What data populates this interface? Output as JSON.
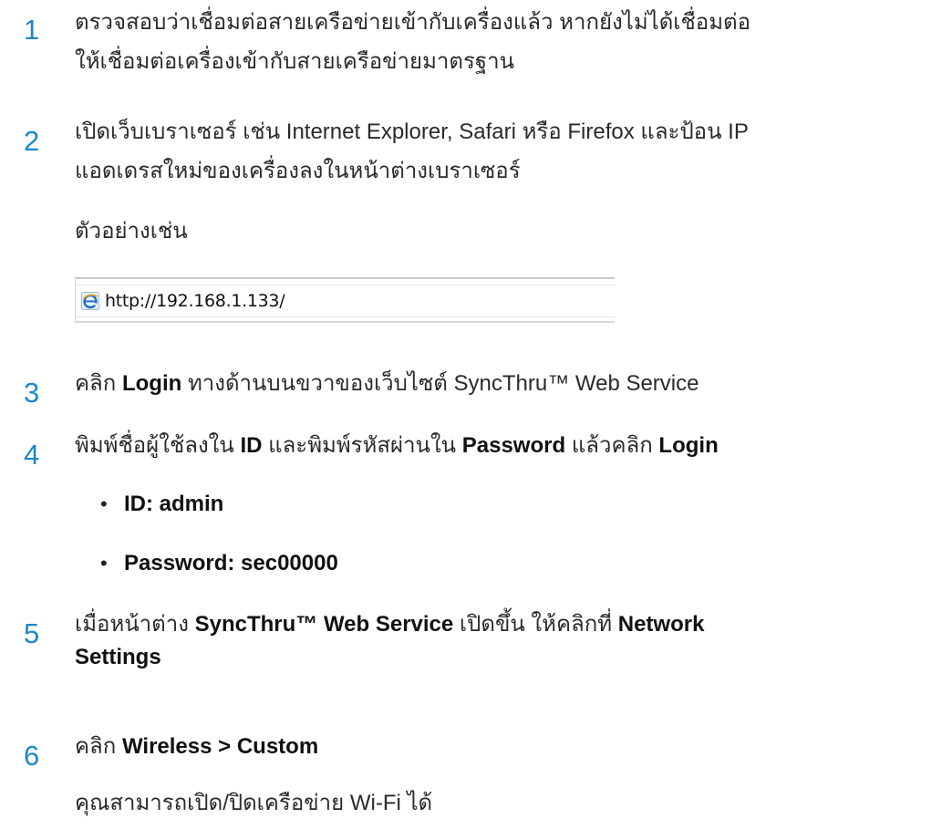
{
  "steps": [
    {
      "number": "1",
      "lines": [
        "ตรวจสอบว่าเชื่อมต่อสายเครือข่ายเข้ากับเครื่องแล้ว หากยังไม่ได้เชื่อมต่อ",
        "ให้เชื่อมต่อเครื่องเข้ากับสายเครือข่ายมาตรฐาน"
      ]
    },
    {
      "number": "2",
      "lines": [
        "เปิดเว็บเบราเซอร์ เช่น Internet Explorer, Safari หรือ Firefox และป้อน IP",
        "แอดเดรสใหม่ของเครื่องลงในหน้าต่างเบราเซอร์"
      ],
      "example_label": "ตัวอย่างเช่น",
      "example_url": "http://192.168.1.133/"
    },
    {
      "number": "3",
      "parts": [
        "คลิก ",
        "Login",
        " ทางด้านบนขวาของเว็บไซต์ SyncThru™ Web Service"
      ]
    },
    {
      "number": "4",
      "parts": [
        "พิมพ์ชื่อผู้ใช้ลงใน ",
        "ID",
        " และพิมพ์รหัสผ่านใน ",
        "Password",
        " แล้วคลิก ",
        "Login"
      ],
      "bullet_mark": "•",
      "bullets": [
        "ID: admin",
        "Password: sec00000"
      ]
    },
    {
      "number": "5",
      "parts": [
        "เมื่อหน้าต่าง ",
        "SyncThru™ Web Service",
        " เปิดขึ้น ให้คลิกที่ ",
        "Network"
      ],
      "line2": "Settings"
    },
    {
      "number": "6",
      "parts": [
        "คลิก ",
        "Wireless > Custom"
      ],
      "note": "คุณสามารถเปิด/ปิดเครือข่าย Wi-Fi ได้"
    }
  ],
  "colors": {
    "step_number": "#1d87c8",
    "text": "#2a2a2a",
    "emphasis": "#111111"
  },
  "icons": {
    "browser": "internet-explorer-icon"
  }
}
